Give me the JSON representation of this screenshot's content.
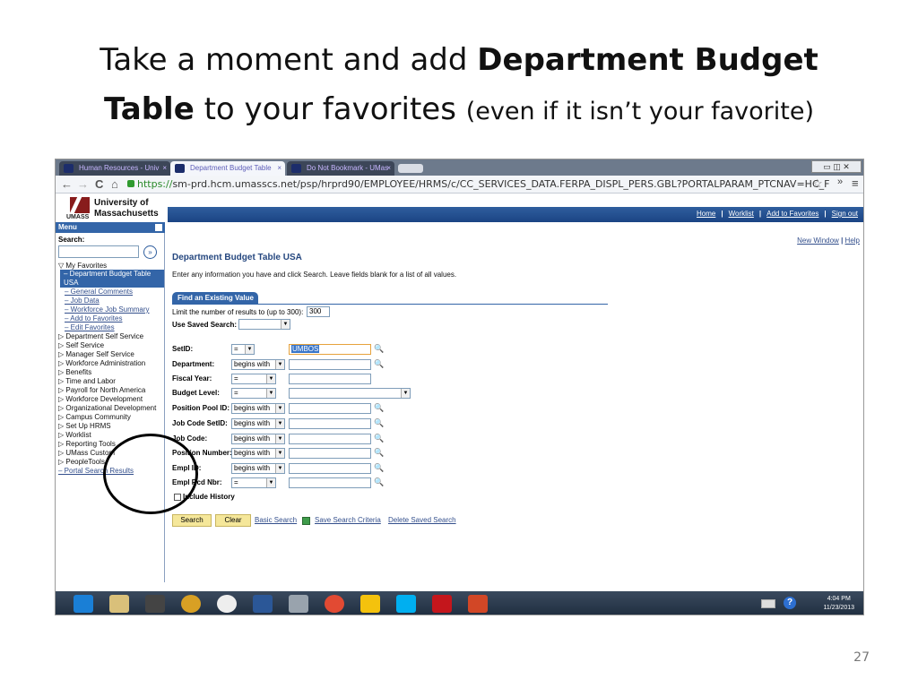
{
  "slide": {
    "title_line1_normal": "Take a moment and add ",
    "title_line1_bold": "Department Budget",
    "title_line2_bold": "Table",
    "title_line2_normal": " to your favorites ",
    "title_line2_small": "(even if it isn’t your favorite)",
    "page_number": "27"
  },
  "browser": {
    "tabs": [
      {
        "label": "Human Resources - Univ",
        "close": "×"
      },
      {
        "label": "Department Budget Table",
        "close": "×"
      },
      {
        "label": "Do Not Bookmark - UMas",
        "close": "×"
      }
    ],
    "back": "←",
    "forward": "→",
    "reload": "C",
    "home": "⌂",
    "url_scheme": "https://",
    "url_rest": "sm-prd.hcm.umasscs.net/psp/hrprd90/EMPLOYEE/HRMS/c/CC_SERVICES_DATA.FERPA_DISPL_PERS.GBL?PORTALPARAM_PTCNAV=HC_FERPA_DISPL_PERS",
    "star": "☆",
    "more": "»",
    "menu": "≡",
    "window_buttons": "▭ ◫ ✕"
  },
  "header": {
    "logo_text": "UMASS",
    "uni_line1": "University of",
    "uni_line2": "Massachusetts",
    "links": [
      "Home",
      "Worklist",
      "Add to Favorites",
      "Sign out"
    ]
  },
  "sidebar": {
    "menu_label": "Menu",
    "search_label": "Search:",
    "search_go": "»",
    "items": [
      "▽ My Favorites",
      "– Department Budget Table",
      "USA",
      "– General Comments",
      "– Job Data",
      "– Workforce Job Summary",
      "– Add to Favorites",
      "– Edit Favorites",
      "▷ Department Self Service",
      "▷ Self Service",
      "▷ Manager Self Service",
      "▷ Workforce Administration",
      "▷ Benefits",
      "▷ Time and Labor",
      "▷ Payroll for North America",
      "▷ Workforce Development",
      "▷ Organizational Development",
      "▷ Campus Community",
      "▷ Set Up HRMS",
      "▷ Worklist",
      "▷ Reporting Tools",
      "▷ UMass Custom",
      "▷ PeopleTools",
      "– Portal Search Results"
    ],
    "scroll_left": "<",
    "scroll_right": ">"
  },
  "content": {
    "new_window": "New Window",
    "help": "Help",
    "separator": "|",
    "page_title": "Department Budget Table USA",
    "instructions": "Enter any information you have and click Search. Leave fields blank for a list of all values.",
    "find_tab": "Find an Existing Value",
    "limit_label": "Limit the number of results to (up to 300):",
    "limit_value": "300",
    "saved_search_label": "Use Saved Search:",
    "fields": [
      {
        "label": "SetID:",
        "op": "=",
        "value": "UMBOS"
      },
      {
        "label": "Department:",
        "op": "begins with",
        "value": ""
      },
      {
        "label": "Fiscal Year:",
        "op": "=",
        "value": ""
      },
      {
        "label": "Budget Level:",
        "op": "=",
        "value": ""
      },
      {
        "label": "Position Pool ID:",
        "op": "begins with",
        "value": ""
      },
      {
        "label": "Job Code SetID:",
        "op": "begins with",
        "value": ""
      },
      {
        "label": "Job Code:",
        "op": "begins with",
        "value": ""
      },
      {
        "label": "Position Number:",
        "op": "begins with",
        "value": ""
      },
      {
        "label": "Empl ID:",
        "op": "begins with",
        "value": ""
      },
      {
        "label": "Empl Rcd Nbr:",
        "op": "=",
        "value": ""
      }
    ],
    "lookup_glyph": "🔍",
    "dropdown_arrow": "▼",
    "include_history": "Include History",
    "search_button": "Search",
    "clear_button": "Clear",
    "basic_search": "Basic Search",
    "save_search": "Save Search Criteria",
    "delete_search": "Delete Saved Search"
  },
  "taskbar": {
    "time": "4:04 PM",
    "date": "11/23/2013",
    "help": "?"
  }
}
